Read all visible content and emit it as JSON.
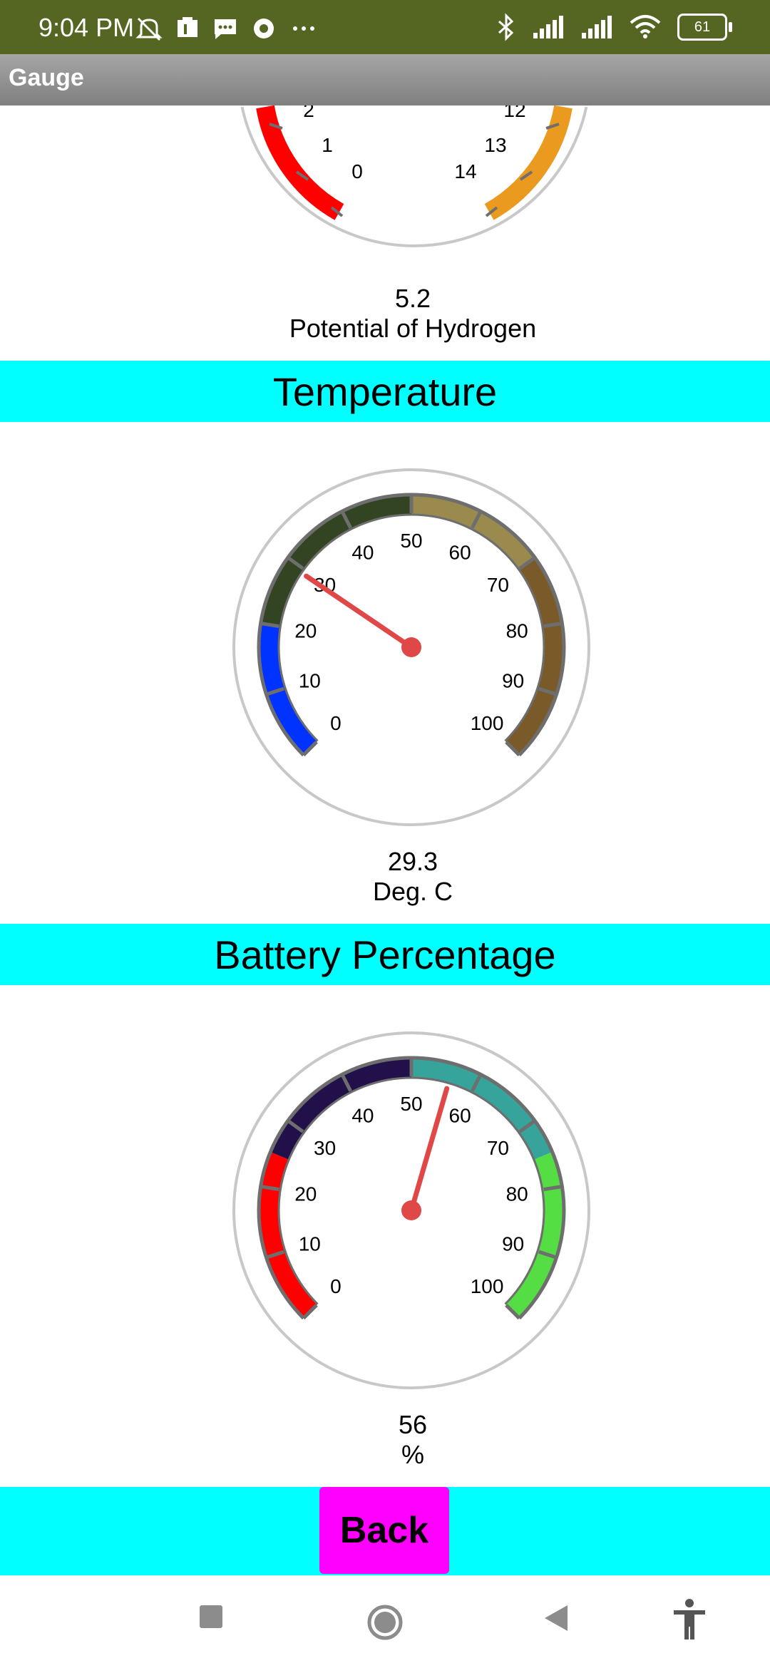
{
  "status_bar": {
    "time": "9:04 PM",
    "battery": "61",
    "left_icons": [
      "mute-icon",
      "sim-icon",
      "message-icon",
      "hotspot-icon",
      "more-icon"
    ],
    "right_icons": [
      "bluetooth-icon",
      "signal-icon",
      "signal-icon",
      "wifi-icon",
      "battery-icon"
    ]
  },
  "app": {
    "title": "Gauge"
  },
  "gauges": [
    {
      "id": "ph",
      "value": "5.2",
      "unit": "Potential of Hydrogen",
      "visible_labels": [
        "2",
        "1",
        "0",
        "12",
        "13",
        "14"
      ],
      "band_colors": {
        "low": "#ff0000",
        "high": "#ea9a1e"
      }
    },
    {
      "id": "temperature",
      "header": "Temperature",
      "value": "29.3",
      "unit": "Deg. C",
      "min": 0,
      "max": 100,
      "labels": [
        "0",
        "10",
        "20",
        "30",
        "40",
        "50",
        "60",
        "70",
        "80",
        "90",
        "100"
      ],
      "bands": [
        {
          "from": 0,
          "to": 20,
          "color": "#0033ff"
        },
        {
          "from": 20,
          "to": 50,
          "color": "#334422"
        },
        {
          "from": 50,
          "to": 70,
          "color": "#9a8a4e"
        },
        {
          "from": 70,
          "to": 100,
          "color": "#7a5a28"
        }
      ]
    },
    {
      "id": "battery",
      "header": "Battery Percentage",
      "value": "56",
      "unit": "%",
      "min": 0,
      "max": 100,
      "labels": [
        "0",
        "10",
        "20",
        "30",
        "40",
        "50",
        "60",
        "70",
        "80",
        "90",
        "100"
      ],
      "bands": [
        {
          "from": 0,
          "to": 25,
          "color": "#ff0000"
        },
        {
          "from": 25,
          "to": 50,
          "color": "#22104a"
        },
        {
          "from": 50,
          "to": 75,
          "color": "#36a49a"
        },
        {
          "from": 75,
          "to": 100,
          "color": "#55dd44"
        }
      ]
    }
  ],
  "buttons": {
    "back_label": "Back"
  },
  "colors": {
    "header_bg": "#00ffff",
    "back_button_bg": "#ff00ff",
    "needle": "#e04848",
    "status_bar": "#556622"
  }
}
